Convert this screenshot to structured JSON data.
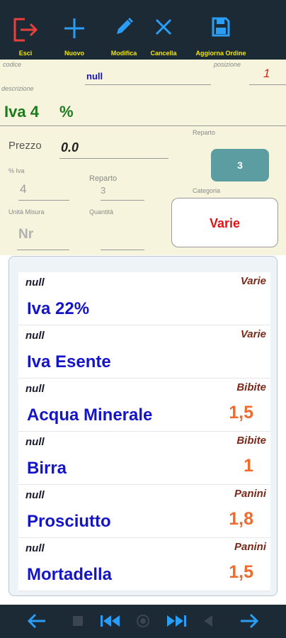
{
  "toolbar": {
    "exit_label": "Esci",
    "new_label": "Nuovo",
    "edit_label": "Modifica",
    "delete_label": "Cancella",
    "update_label": "Aggiorna Ordine",
    "icons": [
      "exit-icon",
      "plus-icon",
      "pencil-icon",
      "close-icon",
      "save-icon"
    ],
    "colors": {
      "exit": "#e8403a",
      "action": "#2a9df4",
      "label": "#f2e600"
    }
  },
  "form": {
    "codice_label": "codice",
    "codice_value": "null",
    "posizione_label": "posizione",
    "posizione_value": "1",
    "descrizione_label": "descrizione",
    "descrizione_value": "Iva 4",
    "percent_symbol": "%",
    "prezzo_label": "Prezzo",
    "prezzo_value": "0.0",
    "reparto_button_label": "Reparto",
    "reparto_button_value": "3",
    "iva_label": "% Iva",
    "iva_value": "4",
    "reparto_label": "Reparto",
    "reparto_value": "3",
    "categoria_label": "Categoria",
    "categoria_value": "Varie",
    "unita_label": "Unità Misura",
    "unita_value": "Nr",
    "quantita_label": "Quantità",
    "quantita_value": ""
  },
  "items": [
    {
      "code": "null",
      "category": "Varie",
      "name": "Iva 22%",
      "price": ""
    },
    {
      "code": "null",
      "category": "Varie",
      "name": "Iva Esente",
      "price": ""
    },
    {
      "code": "null",
      "category": "Bibite",
      "name": "Acqua Minerale",
      "price": "1,5"
    },
    {
      "code": "null",
      "category": "Bibite",
      "name": "Birra",
      "price": "1"
    },
    {
      "code": "null",
      "category": "Panini",
      "name": "Prosciutto",
      "price": "1,8"
    },
    {
      "code": "null",
      "category": "Panini",
      "name": "Mortadella",
      "price": "1,5"
    }
  ],
  "bottom_nav": {
    "icons": [
      "arrow-left-icon",
      "stop-icon",
      "skip-back-icon",
      "record-icon",
      "skip-forward-icon",
      "play-back-icon",
      "arrow-right-icon"
    ]
  }
}
